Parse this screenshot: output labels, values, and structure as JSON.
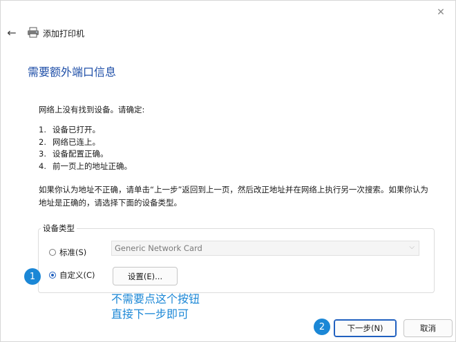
{
  "window": {
    "title": "添加打印机",
    "close_glyph": "✕",
    "back_glyph": "←"
  },
  "page": {
    "heading": "需要额外端口信息",
    "intro": "网络上没有找到设备。请确定:",
    "steps": [
      {
        "num": "1.",
        "text": "设备已打开。"
      },
      {
        "num": "2.",
        "text": "网络已连上。"
      },
      {
        "num": "3.",
        "text": "设备配置正确。"
      },
      {
        "num": "4.",
        "text": "前一页上的地址正确。"
      }
    ],
    "note": "如果你认为地址不正确，请单击“上一步”返回到上一页，然后改正地址并在网络上执行另一次搜索。如果你认为地址是正确的，请选择下面的设备类型。"
  },
  "device_type": {
    "group_label": "设备类型",
    "standard_label": "标准(S)",
    "standard_selected": false,
    "standard_value": "Generic Network Card",
    "custom_label": "自定义(C)",
    "custom_selected": true,
    "settings_button": "设置(E)..."
  },
  "annotations": {
    "badge1": "1",
    "badge2": "2",
    "line1": "不需要点这个按钮",
    "line2": "直接下一步即可"
  },
  "footer": {
    "next_button": "下一步(N)",
    "cancel_button": "取消"
  },
  "colors": {
    "heading": "#1f4fa8",
    "annotation": "#1b87d6",
    "accent": "#1f5fbf"
  }
}
